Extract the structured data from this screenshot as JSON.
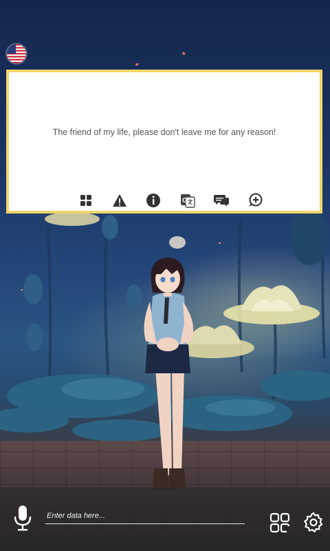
{
  "chat": {
    "message": "The friend of my life, please don't leave me for any reason!"
  },
  "input": {
    "placeholder": "Enter data here..."
  },
  "toolbar": {
    "icons": [
      "grid-icon",
      "warning-icon",
      "info-icon",
      "translate-icon",
      "chat-icon",
      "chat-add-icon"
    ]
  },
  "colors": {
    "panel_border": "#f2d56a",
    "panel_bg": "#ffffff",
    "message_text": "#555555",
    "icon_dark": "#333333",
    "bottom_icons": "#ffffff"
  }
}
